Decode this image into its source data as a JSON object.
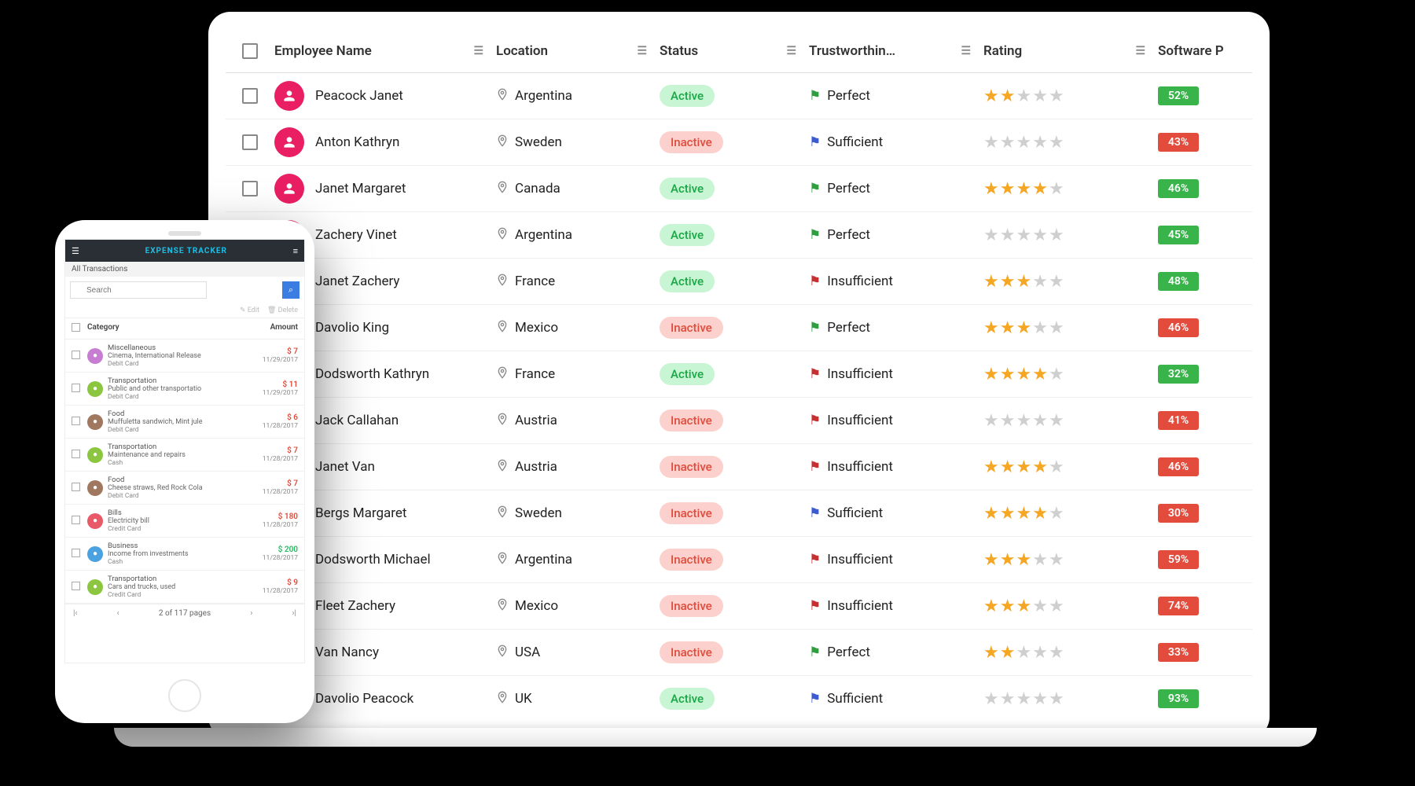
{
  "grid": {
    "columns": [
      "Employee Name",
      "Location",
      "Status",
      "Trustworthin…",
      "Rating",
      "Software P"
    ],
    "rows": [
      {
        "name": "Peacock Janet",
        "loc": "Argentina",
        "status": "Active",
        "trust": "Perfect",
        "flag": "green",
        "rating": 2,
        "soft": "52%",
        "softc": "g"
      },
      {
        "name": "Anton Kathryn",
        "loc": "Sweden",
        "status": "Inactive",
        "trust": "Sufficient",
        "flag": "blue",
        "rating": 0,
        "soft": "43%",
        "softc": "r"
      },
      {
        "name": "Janet Margaret",
        "loc": "Canada",
        "status": "Active",
        "trust": "Perfect",
        "flag": "green",
        "rating": 4,
        "soft": "46%",
        "softc": "g"
      },
      {
        "name": "Zachery Vinet",
        "loc": "Argentina",
        "status": "Active",
        "trust": "Perfect",
        "flag": "green",
        "rating": 0,
        "soft": "45%",
        "softc": "g"
      },
      {
        "name": "Janet Zachery",
        "loc": "France",
        "status": "Active",
        "trust": "Insufficient",
        "flag": "red",
        "rating": 3,
        "soft": "48%",
        "softc": "g"
      },
      {
        "name": "Davolio King",
        "loc": "Mexico",
        "status": "Inactive",
        "trust": "Perfect",
        "flag": "green",
        "rating": 3,
        "soft": "46%",
        "softc": "r"
      },
      {
        "name": "Dodsworth Kathryn",
        "loc": "France",
        "status": "Active",
        "trust": "Insufficient",
        "flag": "red",
        "rating": 4,
        "soft": "32%",
        "softc": "g"
      },
      {
        "name": "Jack Callahan",
        "loc": "Austria",
        "status": "Inactive",
        "trust": "Insufficient",
        "flag": "red",
        "rating": 0,
        "soft": "41%",
        "softc": "r"
      },
      {
        "name": "Janet Van",
        "loc": "Austria",
        "status": "Inactive",
        "trust": "Insufficient",
        "flag": "red",
        "rating": 4,
        "soft": "46%",
        "softc": "r"
      },
      {
        "name": "Bergs Margaret",
        "loc": "Sweden",
        "status": "Inactive",
        "trust": "Sufficient",
        "flag": "blue",
        "rating": 4,
        "soft": "30%",
        "softc": "r"
      },
      {
        "name": "Dodsworth Michael",
        "loc": "Argentina",
        "status": "Inactive",
        "trust": "Insufficient",
        "flag": "red",
        "rating": 3,
        "soft": "59%",
        "softc": "r"
      },
      {
        "name": "Fleet Zachery",
        "loc": "Mexico",
        "status": "Inactive",
        "trust": "Insufficient",
        "flag": "red",
        "rating": 3,
        "soft": "74%",
        "softc": "r"
      },
      {
        "name": "Van Nancy",
        "loc": "USA",
        "status": "Inactive",
        "trust": "Perfect",
        "flag": "green",
        "rating": 2,
        "soft": "33%",
        "softc": "r"
      },
      {
        "name": "Davolio Peacock",
        "loc": "UK",
        "status": "Active",
        "trust": "Sufficient",
        "flag": "blue",
        "rating": 0,
        "soft": "93%",
        "softc": "g"
      }
    ]
  },
  "phone": {
    "title": "EXPENSE TRACKER",
    "subtitle": "All Transactions",
    "search_placeholder": "Search",
    "toolbar": {
      "edit": "Edit",
      "delete": "Delete"
    },
    "columns": {
      "category": "Category",
      "amount": "Amount"
    },
    "rows": [
      {
        "cat": "Miscellaneous",
        "desc": "Cinema, International Release",
        "method": "Debit Card",
        "amt": "$ 7",
        "date": "11/29/2017",
        "color": "#c77dd1",
        "neg": true
      },
      {
        "cat": "Transportation",
        "desc": "Public and other transportatio",
        "method": "Debit Card",
        "amt": "$ 11",
        "date": "11/29/2017",
        "color": "#8cc640",
        "neg": true
      },
      {
        "cat": "Food",
        "desc": "Muffuletta sandwich, Mint jule",
        "method": "Debit Card",
        "amt": "$ 6",
        "date": "11/28/2017",
        "color": "#a07860",
        "neg": true
      },
      {
        "cat": "Transportation",
        "desc": "Maintenance and repairs",
        "method": "Cash",
        "amt": "$ 7",
        "date": "11/28/2017",
        "color": "#8cc640",
        "neg": true
      },
      {
        "cat": "Food",
        "desc": "Cheese straws, Red Rock Cola",
        "method": "Debit Card",
        "amt": "$ 7",
        "date": "11/28/2017",
        "color": "#a07860",
        "neg": true
      },
      {
        "cat": "Bills",
        "desc": "Electricity bill",
        "method": "Credit Card",
        "amt": "$ 180",
        "date": "11/28/2017",
        "color": "#e85a68",
        "neg": true
      },
      {
        "cat": "Business",
        "desc": "Income from investments",
        "method": "Cash",
        "amt": "$ 200",
        "date": "11/28/2017",
        "color": "#4aa3e0",
        "neg": false
      },
      {
        "cat": "Transportation",
        "desc": "Cars and trucks, used",
        "method": "Credit Card",
        "amt": "$ 9",
        "date": "11/28/2017",
        "color": "#8cc640",
        "neg": true
      }
    ],
    "pager": {
      "text": "2 of 117 pages"
    }
  }
}
